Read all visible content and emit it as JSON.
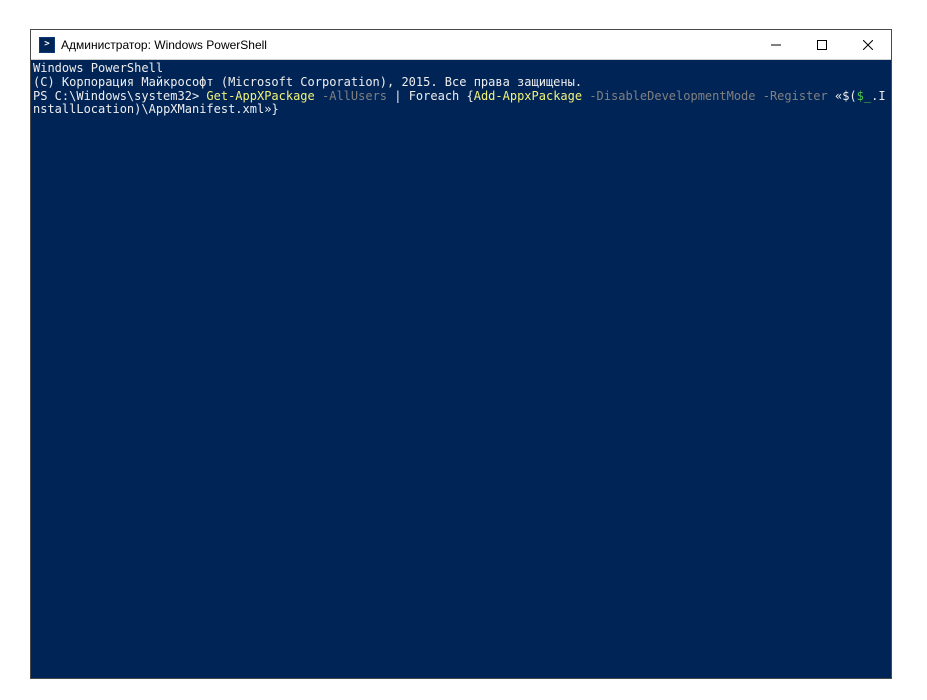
{
  "window": {
    "title": "Администратор: Windows PowerShell"
  },
  "terminal": {
    "header_line1": "Windows PowerShell",
    "header_line2": "(C) Корпорация Майкрософт (Microsoft Corporation), 2015. Все права защищены.",
    "blank": "",
    "prompt": "PS C:\\Windows\\system32> ",
    "cmd_get": "Get-AppXPackage",
    "cmd_allusers": " -AllUsers",
    "cmd_pipe": " | ",
    "cmd_foreach": "Foreach",
    "cmd_brace_open": " {",
    "cmd_add": "Add-AppxPackage",
    "cmd_disable": " -DisableDevelopmentMode",
    "cmd_register": " -Register",
    "cmd_quote_open": " «",
    "cmd_subexpr_open": "$(",
    "cmd_var": "$_",
    "cmd_prop": ".InstallLocation",
    "cmd_subexpr_close": ")",
    "cmd_path": "\\AppXManifest.xml",
    "cmd_quote_close": "»",
    "cmd_brace_close": "}"
  }
}
